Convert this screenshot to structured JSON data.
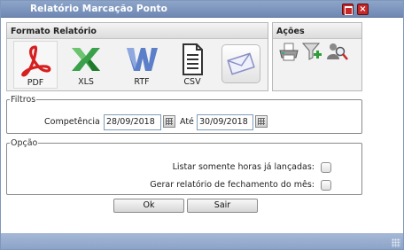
{
  "window": {
    "title": "Relatório Marcação Ponto"
  },
  "format_panel": {
    "header": "Formato Relatório",
    "formats": [
      {
        "label": "PDF",
        "icon": "pdf-icon"
      },
      {
        "label": "XLS",
        "icon": "excel-icon"
      },
      {
        "label": "RTF",
        "icon": "word-icon"
      },
      {
        "label": "CSV",
        "icon": "csv-document-icon"
      },
      {
        "label": "",
        "icon": "email-icon"
      }
    ]
  },
  "actions_panel": {
    "header": "Ações",
    "actions": [
      {
        "icon": "printer-icon"
      },
      {
        "icon": "add-filter-icon"
      },
      {
        "icon": "search-user-icon"
      }
    ]
  },
  "filters": {
    "legend": "Filtros",
    "competencia_label": "Competência :",
    "date_from": "28/09/2018",
    "ate_label": "Até",
    "date_to": "30/09/2018"
  },
  "options": {
    "legend": "Opção",
    "items": [
      {
        "label": "Listar somente horas já lançadas:",
        "checked": false
      },
      {
        "label": "Gerar relatório de fechamento do mês:",
        "checked": false
      }
    ]
  },
  "buttons": {
    "ok": "Ok",
    "sair": "Sair"
  },
  "colors": {
    "titlebar": "#7f97c0",
    "close": "#c62828",
    "statusbar": "#98accd"
  }
}
